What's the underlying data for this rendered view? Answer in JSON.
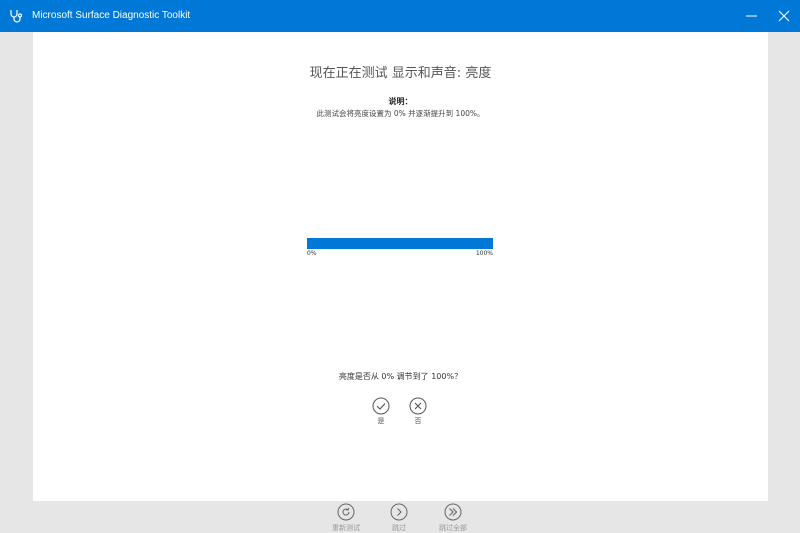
{
  "window": {
    "title": "Microsoft Surface Diagnostic Toolkit",
    "accent_color": "#0078d7",
    "app_icon": "stethoscope-icon"
  },
  "test": {
    "heading": "现在正在测试 显示和声音: 亮度",
    "instructions_label": "说明：",
    "instructions_text": "此测试会将亮度设置为 0% 并逐渐提升到 100%。",
    "progress": {
      "value_percent": 100,
      "min_label": "0%",
      "max_label": "100%"
    },
    "question": "亮度是否从 0% 调节到了 100%？",
    "answers": {
      "yes_label": "是",
      "no_label": "否"
    }
  },
  "footer": {
    "restart_label": "重新测试",
    "skip_label": "跳过",
    "skip_all_label": "跳过全部"
  }
}
